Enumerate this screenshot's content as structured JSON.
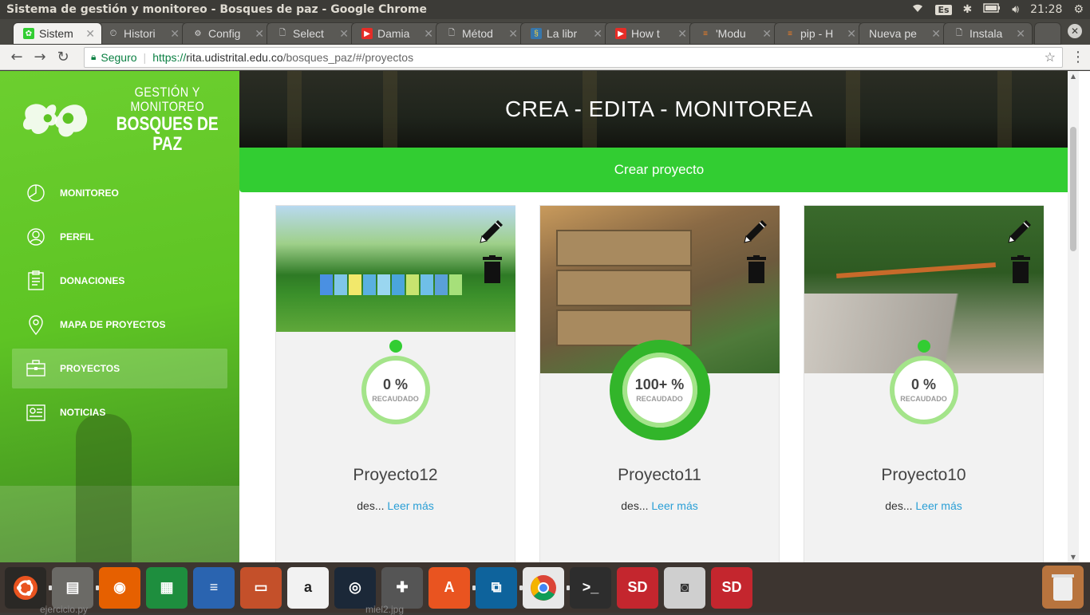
{
  "os": {
    "window_title": "Sistema de gestión y monitoreo - Bosques de paz - Google Chrome",
    "keyboard": "Es",
    "clock": "21:28"
  },
  "tabs": [
    {
      "label": "Sistem",
      "icon": "leaf-favicon",
      "active": true
    },
    {
      "label": "Histori",
      "icon": "history-icon"
    },
    {
      "label": "Config",
      "icon": "gear-icon"
    },
    {
      "label": "Select",
      "icon": "page-icon"
    },
    {
      "label": "Damia",
      "icon": "youtube-icon"
    },
    {
      "label": "Métod",
      "icon": "page-icon"
    },
    {
      "label": "La libr",
      "icon": "python-icon"
    },
    {
      "label": "How t",
      "icon": "youtube-icon"
    },
    {
      "label": "'Modu",
      "icon": "stackoverflow-icon"
    },
    {
      "label": "pip - H",
      "icon": "stackoverflow-icon"
    },
    {
      "label": "Nueva pe",
      "icon": "none"
    },
    {
      "label": "Instala",
      "icon": "page-icon"
    }
  ],
  "address": {
    "secure_label": "Seguro",
    "scheme": "https://",
    "host": "rita.udistrital.edu.co",
    "path": "/bosques_paz/#/proyectos"
  },
  "logo": {
    "line1": "GESTIÓN Y MONITOREO",
    "line2": "BOSQUES DE PAZ"
  },
  "nav": [
    {
      "label": "MONITOREO",
      "icon": "pie-chart-icon",
      "active": false
    },
    {
      "label": "PERFIL",
      "icon": "user-icon",
      "active": false
    },
    {
      "label": "DONACIONES",
      "icon": "clipboard-icon",
      "active": false
    },
    {
      "label": "MAPA DE PROYECTOS",
      "icon": "map-pin-icon",
      "active": false
    },
    {
      "label": "PROYECTOS",
      "icon": "briefcase-icon",
      "active": true
    },
    {
      "label": "NOTICIAS",
      "icon": "newspaper-icon",
      "active": false
    }
  ],
  "hero": {
    "title": "CREA - EDITA - MONITOREA"
  },
  "create_button": "Crear proyecto",
  "projects": [
    {
      "name": "Proyecto12",
      "percent": "0 %",
      "progress": 0,
      "raised_label": "RECAUDADO",
      "desc": "des...",
      "more": "Leer más"
    },
    {
      "name": "Proyecto11",
      "percent": "100+ %",
      "progress": 1,
      "raised_label": "RECAUDADO",
      "desc": "des...",
      "more": "Leer más"
    },
    {
      "name": "Proyecto10",
      "percent": "0 %",
      "progress": 0,
      "raised_label": "RECAUDADO",
      "desc": "des...",
      "more": "Leer más"
    }
  ],
  "desktop": {
    "file1": "ejercicio.py",
    "file2": "miel2.jpg"
  },
  "colors": {
    "brand_green": "#32cd32",
    "sidebar_green": "#5ec424",
    "link_blue": "#2a9fd6",
    "ring_light": "#a4e48a",
    "ring_dark": "#32b52a"
  }
}
